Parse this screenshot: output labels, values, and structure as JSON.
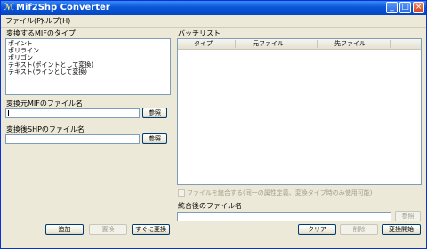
{
  "window": {
    "title": "Mif2Shp Converter"
  },
  "titlebar_buttons": {
    "minimize": "_",
    "maximize": "□",
    "close": "×"
  },
  "menu": {
    "file": "ファイル(F)",
    "help": "ヘルプ(H)"
  },
  "type_section": {
    "label": "変換するMIFのタイプ",
    "items": [
      "ポイント",
      "ポリライン",
      "ポリゴン",
      "テキスト(ポイントとして変換)",
      "テキスト(ラインとして変換)"
    ]
  },
  "source": {
    "label": "変換元MIFのファイル名",
    "value": "",
    "browse": "参照"
  },
  "target": {
    "label": "変換後SHPのファイル名",
    "value": "",
    "browse": "参照"
  },
  "left_buttons": {
    "add": "追加",
    "replace": "置換",
    "convert_now": "すぐに変換"
  },
  "batch": {
    "label": "バッチリスト",
    "columns": [
      "タイプ",
      "元ファイル",
      "先ファイル"
    ]
  },
  "merge": {
    "checkbox_label": "ファイルを統合する(同一の属性定義、変換タイプ時のみ使用可能)",
    "filename_label": "統合後のファイル名",
    "value": "",
    "browse": "参照"
  },
  "right_buttons": {
    "clear": "クリア",
    "delete": "削除",
    "start": "変換開始"
  }
}
